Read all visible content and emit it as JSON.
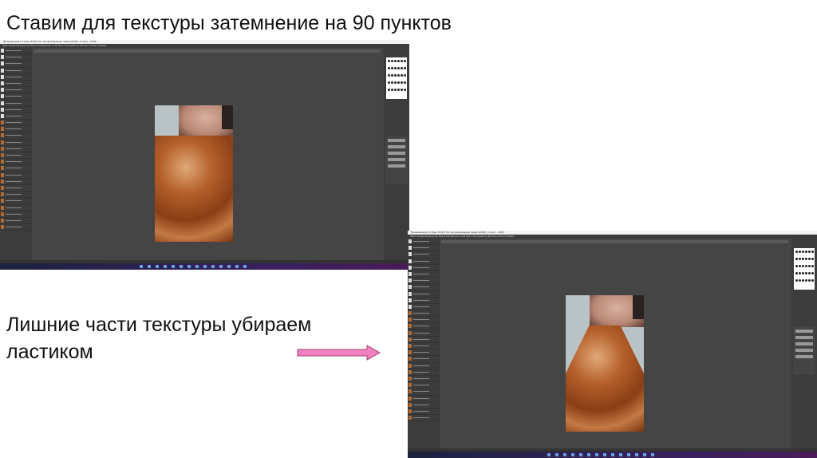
{
  "slide": {
    "title": "Ставим для текстуры затемнение на 90 пунктов",
    "caption": "Лишние части текстуры убираем ластиком",
    "arrow_color": "#f080c0"
  },
  "screenshots": [
    {
      "app": "GIMP",
      "title_bar": "[Безымянный]-1.0 (Цвет RGB 8 бит, воспринимаемая гамма (sRGB), 3 слоя) – GIMP",
      "menu": "Файл Правка Выделение Вид Изображение Слой Цвет Инструменты Фильтры Окна Справка"
    },
    {
      "app": "GIMP",
      "title_bar": "[Безымянный]-1.0 (Цвет RGB 8 бит, воспринимаемая гамма (sRGB), 3 слоя) – GIMP",
      "menu": "Файл Правка Выделение Вид Изображение Слой Цвет Инструменты Фильтры Окна Справка"
    }
  ]
}
